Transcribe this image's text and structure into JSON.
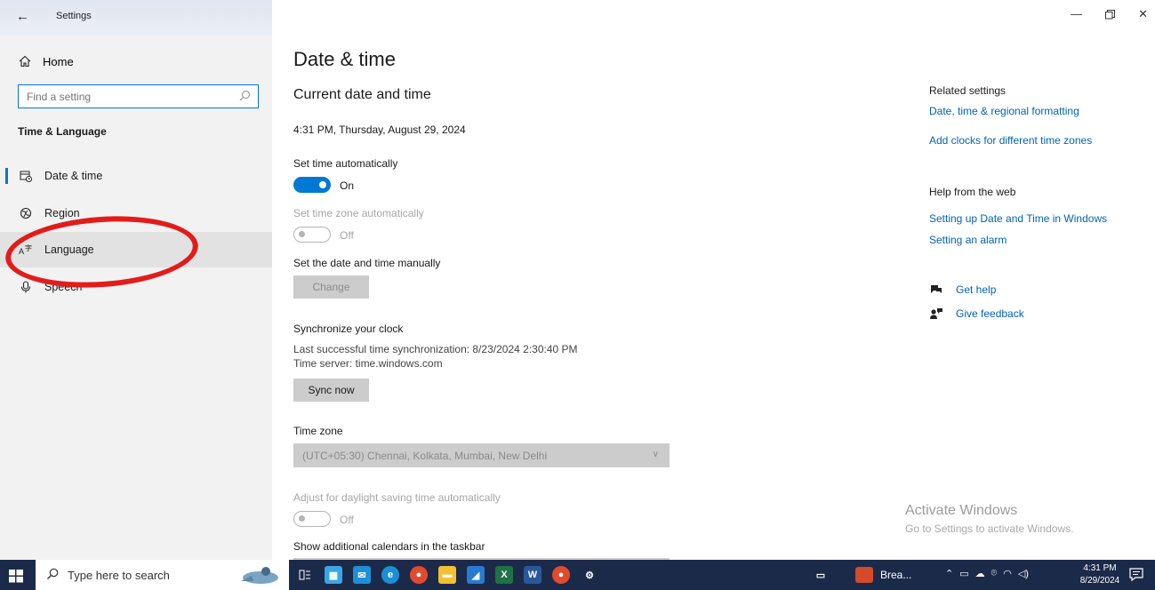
{
  "window": {
    "title": "Settings"
  },
  "sidebar": {
    "home_label": "Home",
    "search_placeholder": "Find a setting",
    "section_title": "Time & Language",
    "items": [
      {
        "label": "Date & time",
        "icon": "calendar-clock-icon"
      },
      {
        "label": "Region",
        "icon": "globe-icon"
      },
      {
        "label": "Language",
        "icon": "language-icon"
      },
      {
        "label": "Speech",
        "icon": "microphone-icon"
      }
    ]
  },
  "main": {
    "title": "Date & time",
    "current_heading": "Current date and time",
    "current_value": "4:31 PM, Thursday, August 29, 2024",
    "set_time_auto_label": "Set time automatically",
    "set_time_auto_state": "On",
    "set_tz_auto_label": "Set time zone automatically",
    "set_tz_auto_state": "Off",
    "manual_label": "Set the date and time manually",
    "change_button": "Change",
    "sync_heading": "Synchronize your clock",
    "sync_last": "Last successful time synchronization: 8/23/2024 2:30:40 PM",
    "sync_server": "Time server: time.windows.com",
    "sync_button": "Sync now",
    "timezone_label": "Time zone",
    "timezone_value": "(UTC+05:30) Chennai, Kolkata, Mumbai, New Delhi",
    "dst_label": "Adjust for daylight saving time automatically",
    "dst_state": "Off",
    "calendars_label": "Show additional calendars in the taskbar"
  },
  "related": {
    "heading": "Related settings",
    "link1": "Date, time & regional formatting",
    "link2": "Add clocks for different time zones",
    "help_heading": "Help from the web",
    "help_link1": "Setting up Date and Time in Windows",
    "help_link2": "Setting an alarm",
    "get_help": "Get help",
    "give_feedback": "Give feedback"
  },
  "watermark": {
    "line1": "Activate Windows",
    "line2": "Go to Settings to activate Windows."
  },
  "taskbar": {
    "search_placeholder": "Type here to search",
    "app_label": "Brea...",
    "time": "4:31 PM",
    "date": "8/29/2024",
    "accent": "#0078d4"
  }
}
